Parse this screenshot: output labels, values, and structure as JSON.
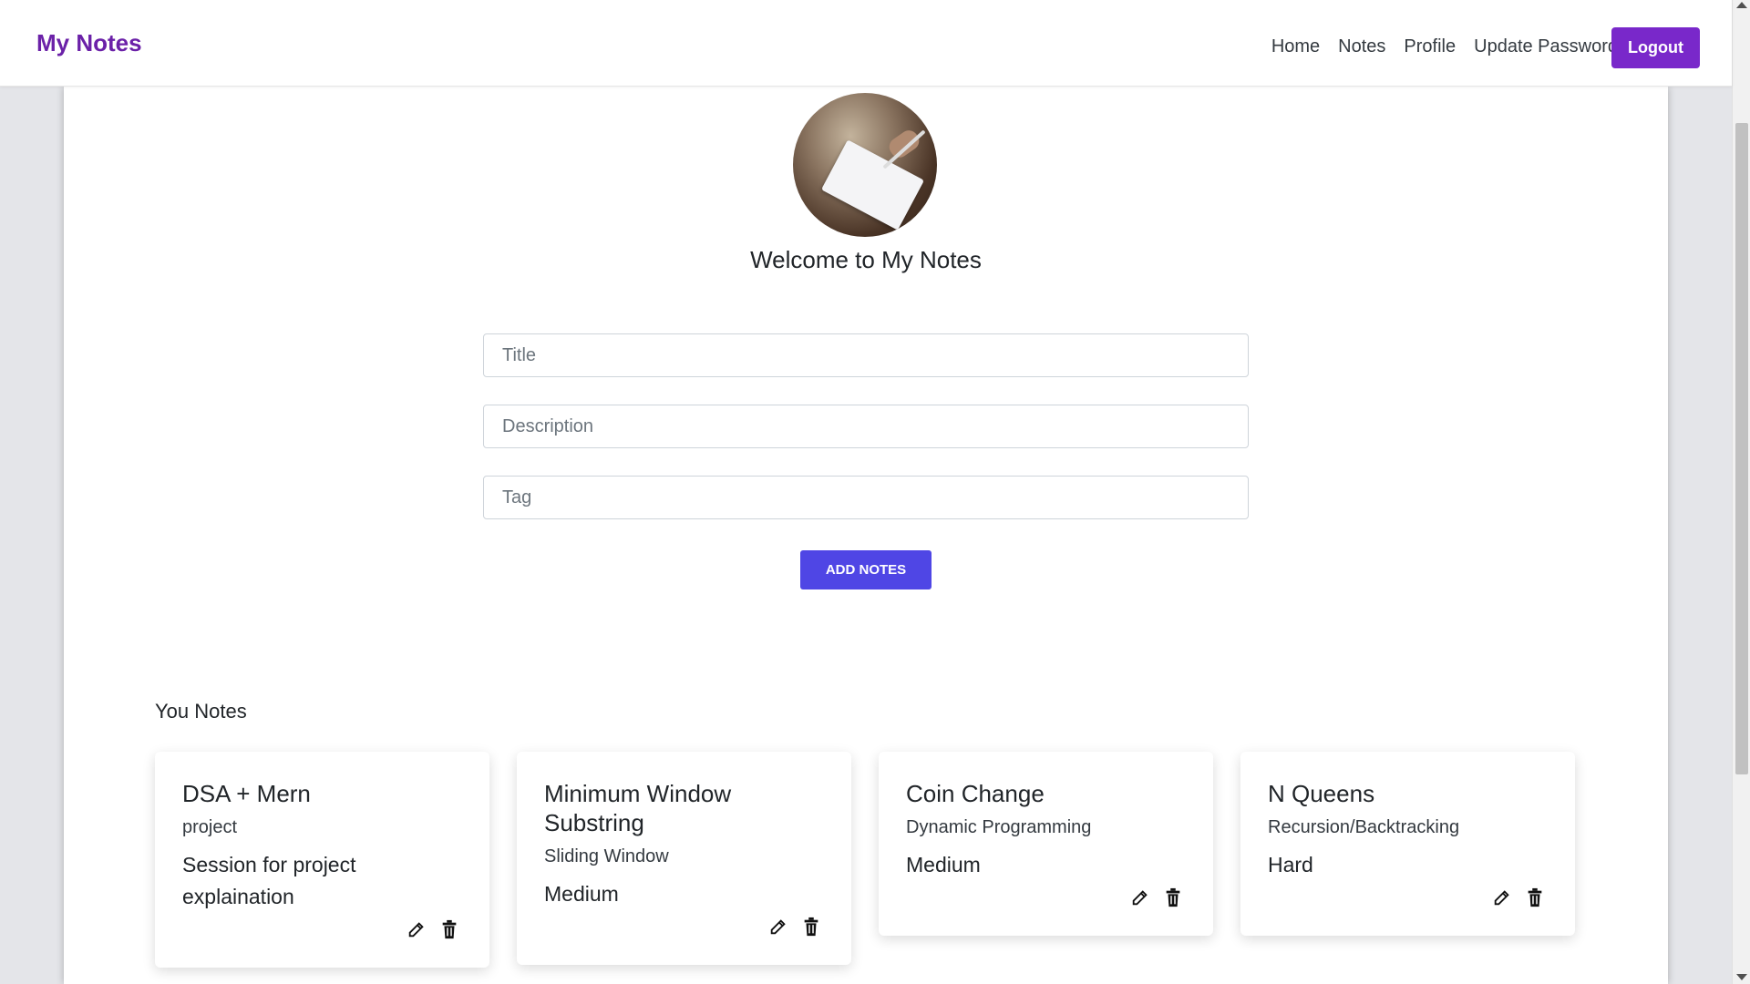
{
  "navbar": {
    "brand": "My Notes",
    "links": [
      "Home",
      "Notes",
      "Profile",
      "Update Password"
    ],
    "logout_label": "Logout"
  },
  "hero": {
    "welcome": "Welcome to My Notes"
  },
  "form": {
    "title_placeholder": "Title",
    "description_placeholder": "Description",
    "tag_placeholder": "Tag",
    "add_label": "ADD NOTES"
  },
  "notes_section": {
    "heading": "You Notes",
    "notes": [
      {
        "title": "DSA + Mern",
        "tag": "project",
        "description": "Session for project explaination"
      },
      {
        "title": "Minimum Window Substring",
        "tag": "Sliding Window",
        "description": "Medium"
      },
      {
        "title": "Coin Change",
        "tag": "Dynamic Programming",
        "description": "Medium"
      },
      {
        "title": "N Queens",
        "tag": "Recursion/Backtracking",
        "description": "Hard"
      }
    ]
  },
  "colors": {
    "brand": "#6b21a8",
    "logout": "#7928ca",
    "add_button": "#4f46e5"
  },
  "icons": {
    "edit": "edit-icon",
    "delete": "trash-icon"
  }
}
